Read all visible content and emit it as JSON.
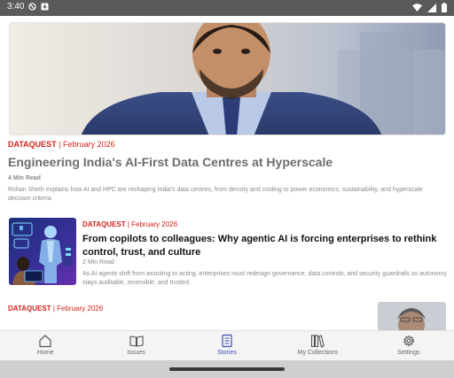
{
  "status_bar": {
    "time": "3:40"
  },
  "articles": [
    {
      "source": "DATAQUEST",
      "date": "February 2026",
      "title": "Engineering India's AI-First Data Centres at Hyperscale",
      "read_time": "4 Min Read",
      "summary": "Rohan Sheth explains how AI and HPC are reshaping India's data centres, from density and cooling to power economics, sustainability, and hyperscale decision criteria."
    },
    {
      "source": "DATAQUEST",
      "date": "February 2026",
      "title": "From copilots to colleagues: Why agentic AI is forcing enterprises to rethink control, trust, and culture",
      "read_time": "2 Min Read",
      "summary": "As AI agents shift from assisting to acting, enterprises must redesign governance, data controls, and security guardrails so autonomy stays auditable, reversible, and trusted."
    },
    {
      "source": "DATAQUEST",
      "date": "February 2026"
    }
  ],
  "kicker_separator": "|",
  "bottom_nav": {
    "active": "Stories",
    "items": [
      {
        "label": "Home",
        "icon": "home-icon"
      },
      {
        "label": "Issues",
        "icon": "book-open-icon"
      },
      {
        "label": "Stories",
        "icon": "document-icon"
      },
      {
        "label": "My Collections",
        "icon": "library-icon"
      },
      {
        "label": "Settings",
        "icon": "gear-icon"
      }
    ]
  },
  "colors": {
    "accent_red": "#d0241b",
    "active_nav": "#3f4fb5",
    "status_bar": "#5a5a5a",
    "muted_text": "#8a8a8a"
  }
}
